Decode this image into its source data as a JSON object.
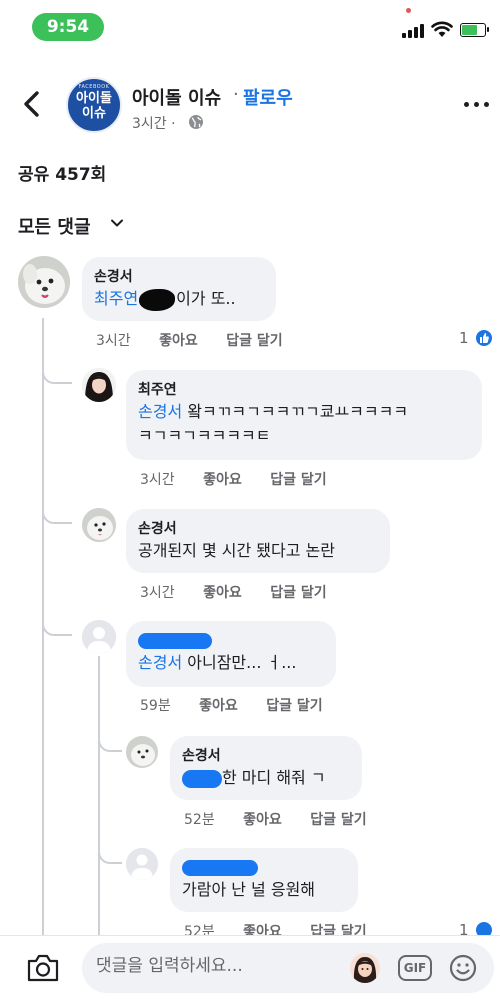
{
  "status_bar": {
    "time": "9:54"
  },
  "header": {
    "page_logo_small": "FACEBOOK",
    "page_logo_line1": "아이돌",
    "page_logo_line2": "이슈",
    "page_name": "아이돌 이슈",
    "separator": "·",
    "follow_label": "팔로우",
    "post_time": "3시간 ·",
    "globe_icon": "globe-icon",
    "more_icon": "more-dots-icon",
    "back_icon": "chevron-left-icon"
  },
  "post": {
    "share_count": "공유 457회"
  },
  "comments_filter": {
    "label": "모든 댓글",
    "icon": "chevron-down-icon"
  },
  "comments": [
    {
      "author": "손경서",
      "mention": "최주연",
      "text_after": "이가 또..",
      "time": "3시간",
      "like_label": "좋아요",
      "reply_label": "답글 달기",
      "reaction_count": "1",
      "reaction_icon": "thumbs-up-icon"
    },
    {
      "author": "최주연",
      "mention": "손경서",
      "text_line1": "왘ㅋㄲㅋㄱㅋㅋㄲㄱ쿄ㅛㅋㅋㅋㅋ",
      "text_line2": "ㅋㄱㅋㄱㅋㅋㅋㅋㅌ",
      "time": "3시간",
      "like_label": "좋아요",
      "reply_label": "답글 달기"
    },
    {
      "author": "손경서",
      "text": "공개된지 몇 시간 됐다고 논란",
      "time": "3시간",
      "like_label": "좋아요",
      "reply_label": "답글 달기"
    },
    {
      "mention": "손경서",
      "text_after": "아니잠만... ㅓ...",
      "time": "59분",
      "like_label": "좋아요",
      "reply_label": "답글 달기"
    },
    {
      "author": "손경서",
      "text_after": "한 마디 해줘 ㄱ",
      "time": "52분",
      "like_label": "좋아요",
      "reply_label": "답글 달기"
    },
    {
      "text": "가람아 난 널 응원해",
      "time": "52분",
      "like_label": "좋아요",
      "reply_label": "답글 달기",
      "reaction_count": "1"
    }
  ],
  "composer": {
    "placeholder": "댓글을 입력하세요...",
    "camera_icon": "camera-icon",
    "gif_label": "GIF",
    "emoji_icon": "smiley-icon"
  },
  "colors": {
    "brand": "#1b74e4",
    "bubble": "#f0f2f5",
    "muted": "#65676b",
    "status_green": "#3cc05a"
  }
}
